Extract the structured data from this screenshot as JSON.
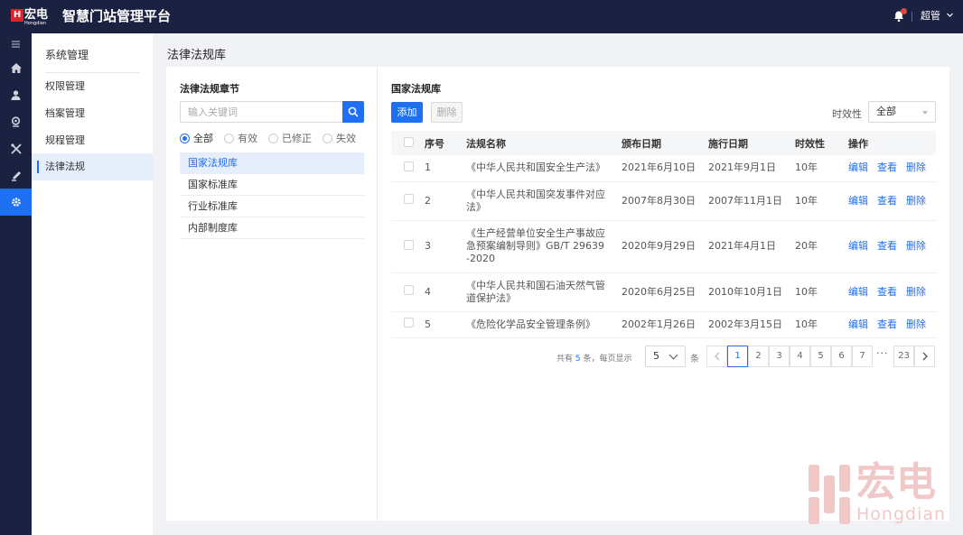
{
  "brand": {
    "logo_mark": "H",
    "logo_cn": "宏电",
    "logo_en": "Hongdian",
    "app_title": "智慧门站管理平台"
  },
  "header": {
    "notification_count": "1",
    "user_name": "超管"
  },
  "iconbar": [
    "menu-icon",
    "home-icon",
    "user-icon",
    "location-icon",
    "tools-icon",
    "pen-icon",
    "gear-icon"
  ],
  "menu": {
    "title": "系统管理",
    "items": [
      {
        "label": "权限管理"
      },
      {
        "label": "档案管理"
      },
      {
        "label": "规程管理"
      },
      {
        "label": "法律法规"
      }
    ]
  },
  "page": {
    "title": "法律法规库"
  },
  "left_panel": {
    "title": "法律法规章节",
    "search_placeholder": "输入关键词",
    "filters": [
      {
        "label": "全部",
        "checked": true
      },
      {
        "label": "有效"
      },
      {
        "label": "已修正"
      },
      {
        "label": "失效"
      }
    ],
    "categories": [
      {
        "label": "国家法规库"
      },
      {
        "label": "国家标准库"
      },
      {
        "label": "行业标准库"
      },
      {
        "label": "内部制度库"
      }
    ]
  },
  "right_panel": {
    "title": "国家法规库",
    "add_label": "添加",
    "delete_label": "删除",
    "filter_label": "时效性",
    "filter_value": "全部"
  },
  "table": {
    "headers": {
      "index": "序号",
      "name": "法规名称",
      "published": "颁布日期",
      "effective": "施行日期",
      "validity": "时效性",
      "actions": "操作"
    },
    "rows": [
      {
        "index": "1",
        "name": "《中华人民共和国安全生产法》",
        "published": "2021年6月10日",
        "effective": "2021年9月1日",
        "validity": "10年"
      },
      {
        "index": "2",
        "name": "《中华人民共和国突发事件对应法》",
        "published": "2007年8月30日",
        "effective": "2007年11月1日",
        "validity": "10年"
      },
      {
        "index": "3",
        "name": "《生产经营单位安全生产事故应急预案编制导则》GB/T 29639-2020",
        "published": "2020年9月29日",
        "effective": "2021年4月1日",
        "validity": "20年"
      },
      {
        "index": "4",
        "name": "《中华人民共和国石油天然气管道保护法》",
        "published": "2020年6月25日",
        "effective": "2010年10月1日",
        "validity": "10年"
      },
      {
        "index": "5",
        "name": "《危险化学品安全管理条例》",
        "published": "2002年1月26日",
        "effective": "2002年3月15日",
        "validity": "10年"
      }
    ],
    "actions": {
      "edit": "编辑",
      "view": "查看",
      "delete": "删除"
    }
  },
  "pagination": {
    "total_prefix": "共有",
    "total": "5",
    "total_suffix": "条，每页显示",
    "page_size": "5",
    "unit": "条",
    "pages": [
      "1",
      "2",
      "3",
      "4",
      "5",
      "6",
      "7"
    ],
    "ellipsis": "···",
    "last_page": "23",
    "current": "1"
  },
  "watermark": {
    "cn": "宏电",
    "en": "Hongdian"
  }
}
